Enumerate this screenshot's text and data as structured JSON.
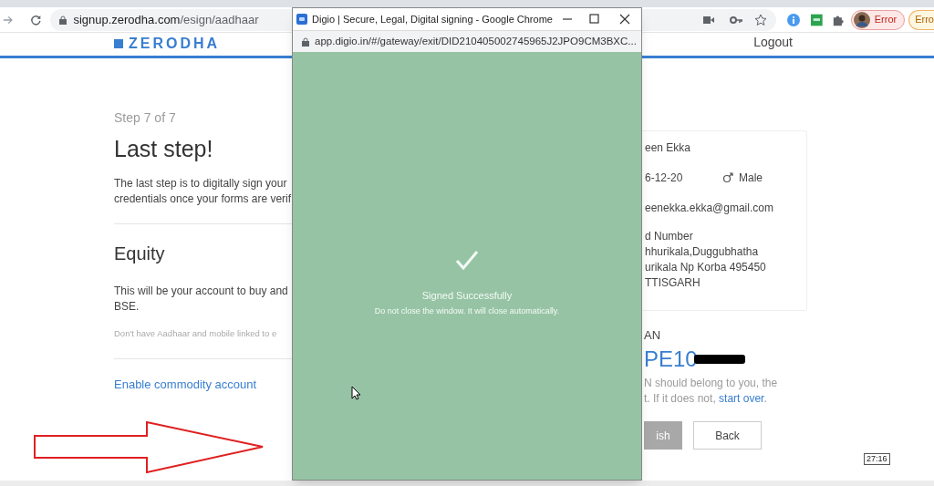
{
  "browser": {
    "url_host": "signup.zerodha.com",
    "url_path": "/esign/aadhaar",
    "profile_chips": [
      {
        "label": "Error",
        "kind": "profile"
      },
      {
        "label": "Erro",
        "kind": "plain"
      }
    ]
  },
  "header": {
    "logo": "ZERODHA",
    "logout": "Logout"
  },
  "left": {
    "step": "Step 7 of 7",
    "title": "Last step!",
    "intro_lines": [
      "The last step is to digitally sign your",
      "credentials once your forms are verif"
    ],
    "section_title": "Equity",
    "section_lines": [
      "This will be your account to buy and",
      "BSE."
    ],
    "note": "Don't have Aadhaar and mobile linked to e",
    "link": "Enable commodity account"
  },
  "card": {
    "name": "een Ekka",
    "dob": "6-12-20",
    "gender": "Male",
    "email": "eenekka.ekka@gmail.com",
    "address_lines": [
      "d Number",
      "hhurikala,Duggubhatha",
      "urikala Np Korba 495450",
      "TTISGARH"
    ]
  },
  "pan": {
    "label": "AN",
    "value": "PE10",
    "note_line": "N should belong to you, the",
    "note_before": "t. If it does not, ",
    "link": "start over",
    "note_after": "."
  },
  "buttons": [
    {
      "label": "ish",
      "kind": "primary",
      "disabled": true
    },
    {
      "label": "Back",
      "kind": "secondary",
      "disabled": false
    }
  ],
  "popup": {
    "title": "Digio | Secure, Legal, Digital signing - Google Chrome",
    "url": "app.digio.in/#/gateway/exit/DID210405002745965J2JPO9CM3BXC...",
    "status": "Signed Successfully",
    "message": "Do not close the window. It will close automatically."
  },
  "video_timestamp": "27:16"
}
